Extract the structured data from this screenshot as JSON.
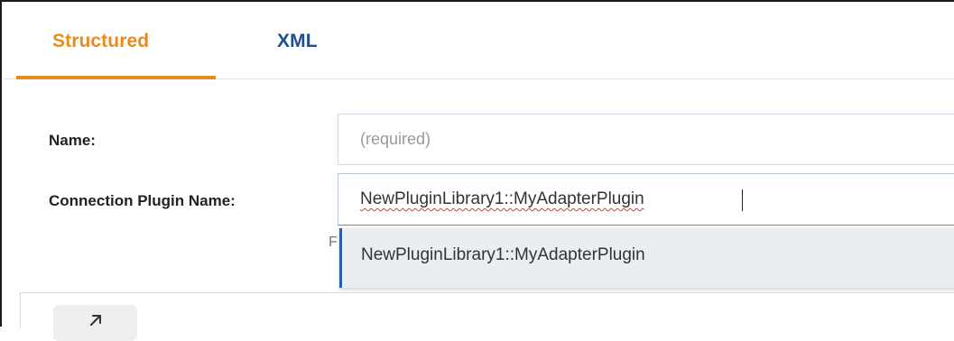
{
  "tabs": [
    {
      "label": "Structured",
      "active": true
    },
    {
      "label": "XML",
      "active": false
    }
  ],
  "form": {
    "name_label": "Name:",
    "name_placeholder": "(required)",
    "plugin_label": "Connection Plugin Name:",
    "plugin_value": "NewPluginLibrary1::MyAdapterPlugin",
    "hint_fragment": "F"
  },
  "autocomplete": {
    "options": [
      "NewPluginLibrary1::MyAdapterPlugin"
    ]
  },
  "panel": {
    "expand_icon": "arrow-up-right-icon"
  },
  "colors": {
    "active_tab": "#e88b1c",
    "inactive_tab": "#1f4e8c",
    "dropdown_bg": "#eaeef3",
    "dropdown_accent": "#2c5e9a"
  }
}
